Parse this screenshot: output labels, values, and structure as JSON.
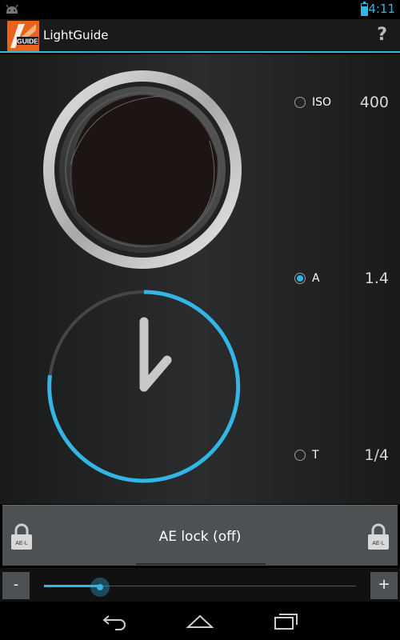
{
  "status_bar": {
    "time": "4:11"
  },
  "app": {
    "title": "LightGuide",
    "logo_text": "GUIDE",
    "help_label": "?"
  },
  "settings": [
    {
      "label": "ISO",
      "value": "400",
      "selected": false
    },
    {
      "label": "A",
      "value": "1.4",
      "selected": true
    },
    {
      "label": "T",
      "value": "1/4",
      "selected": false
    }
  ],
  "ae_lock": {
    "label": "AE lock (off)",
    "lock_icon_text": "AE-L"
  },
  "slider": {
    "minus_label": "-",
    "plus_label": "+",
    "position_fraction": 0.18
  },
  "colors": {
    "accent": "#33b5e5"
  },
  "icons": [
    "android-icon",
    "battery-icon",
    "help-icon",
    "lock-icon",
    "back-icon",
    "home-icon",
    "recent-apps-icon"
  ]
}
